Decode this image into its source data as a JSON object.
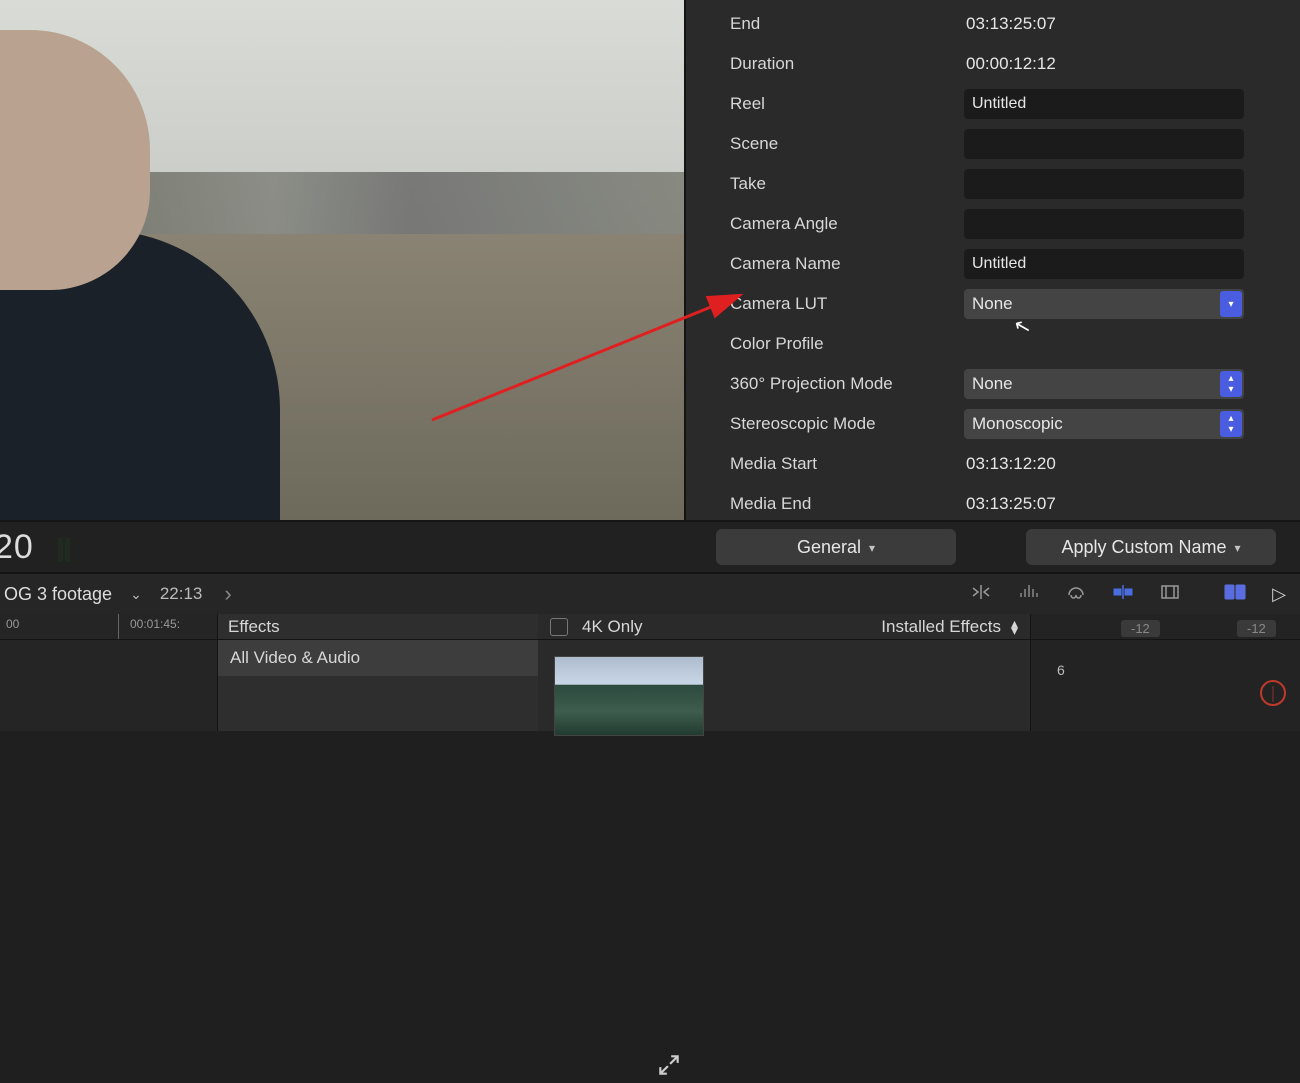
{
  "inspector": {
    "end": {
      "label": "End",
      "value": "03:13:25:07"
    },
    "duration": {
      "label": "Duration",
      "value": "00:00:12:12"
    },
    "reel": {
      "label": "Reel",
      "value": "Untitled"
    },
    "scene": {
      "label": "Scene",
      "value": ""
    },
    "take": {
      "label": "Take",
      "value": ""
    },
    "camera_angle": {
      "label": "Camera Angle",
      "value": ""
    },
    "camera_name": {
      "label": "Camera Name",
      "value": "Untitled"
    },
    "camera_lut": {
      "label": "Camera LUT",
      "value": "None"
    },
    "color_profile": {
      "label": "Color Profile",
      "value": ""
    },
    "projection": {
      "label": "360° Projection Mode",
      "value": "None"
    },
    "stereo": {
      "label": "Stereoscopic Mode",
      "value": "Monoscopic"
    },
    "media_start": {
      "label": "Media Start",
      "value": "03:13:12:20"
    },
    "media_end": {
      "label": "Media End",
      "value": "03:13:25:07"
    }
  },
  "controlbar": {
    "timecode_fragment": "20",
    "general_btn": "General",
    "custom_name_btn": "Apply Custom Name"
  },
  "project": {
    "name_fragment": "OG 3 footage",
    "duration": "22:13"
  },
  "ruler": {
    "tick0": "00",
    "tick1": "00:01:45:"
  },
  "effects": {
    "title": "Effects",
    "item0": "All Video & Audio"
  },
  "browser": {
    "filter_label": "4K Only",
    "dropdown": "Installed Effects"
  },
  "audio": {
    "db_left": "-12",
    "db_right": "-12",
    "scale_6": "6"
  }
}
